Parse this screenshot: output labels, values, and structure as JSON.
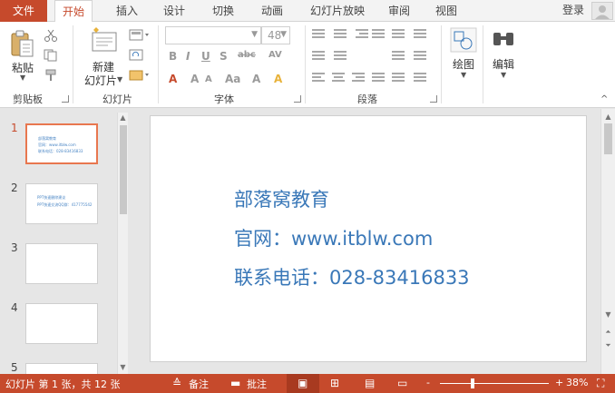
{
  "ribbon_tabs": {
    "file": "文件",
    "home": "开始",
    "insert": "插入",
    "design": "设计",
    "transitions": "切换",
    "animations": "动画",
    "slideshow": "幻灯片放映",
    "review": "审阅",
    "view": "视图"
  },
  "account": {
    "login": "登录"
  },
  "clipboard": {
    "paste_label": "粘贴",
    "group_label": "剪贴板"
  },
  "slides_group": {
    "new_slide_line1": "新建",
    "new_slide_line2": "幻灯片",
    "group_label": "幻灯片"
  },
  "font_group": {
    "font_size": "48",
    "group_label": "字体"
  },
  "paragraph_group": {
    "group_label": "段落"
  },
  "drawing": {
    "label": "绘图"
  },
  "editing": {
    "label": "编辑"
  },
  "thumbnails": [
    {
      "num": "1",
      "lines": [
        "部落窝教育",
        "官网：www.itblw.com",
        "联系电话：028-83416833"
      ]
    },
    {
      "num": "2",
      "lines": [
        "PPT快速删除建议",
        "PPT快速交流QQ群：417775542"
      ]
    },
    {
      "num": "3",
      "lines": []
    },
    {
      "num": "4",
      "lines": []
    },
    {
      "num": "5",
      "lines": []
    }
  ],
  "slide": {
    "line1": "部落窝教育",
    "line2": "官网：www.itblw.com",
    "line3": "联系电话：028-83416833"
  },
  "status": {
    "slide_info": "幻灯片 第 1 张，共 12 张",
    "notes": "备注",
    "comments": "批注",
    "zoom": "38%",
    "zoom_out": "-",
    "zoom_in": "+"
  },
  "colors": {
    "accent": "#c64a2c",
    "slide_text": "#3a78b8"
  }
}
